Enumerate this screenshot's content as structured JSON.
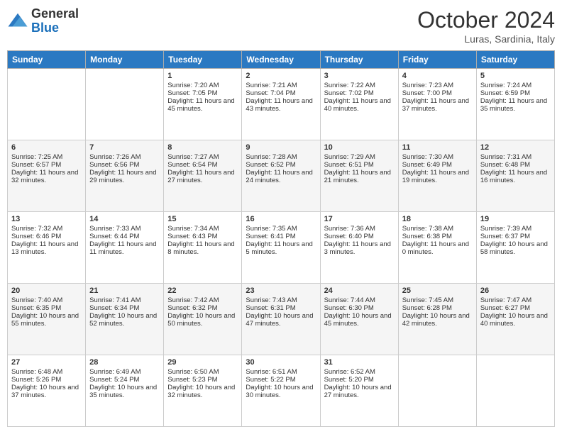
{
  "header": {
    "logo_general": "General",
    "logo_blue": "Blue",
    "month": "October 2024",
    "location": "Luras, Sardinia, Italy"
  },
  "weekdays": [
    "Sunday",
    "Monday",
    "Tuesday",
    "Wednesday",
    "Thursday",
    "Friday",
    "Saturday"
  ],
  "weeks": [
    [
      {
        "day": "",
        "sunrise": "",
        "sunset": "",
        "daylight": ""
      },
      {
        "day": "",
        "sunrise": "",
        "sunset": "",
        "daylight": ""
      },
      {
        "day": "1",
        "sunrise": "Sunrise: 7:20 AM",
        "sunset": "Sunset: 7:05 PM",
        "daylight": "Daylight: 11 hours and 45 minutes."
      },
      {
        "day": "2",
        "sunrise": "Sunrise: 7:21 AM",
        "sunset": "Sunset: 7:04 PM",
        "daylight": "Daylight: 11 hours and 43 minutes."
      },
      {
        "day": "3",
        "sunrise": "Sunrise: 7:22 AM",
        "sunset": "Sunset: 7:02 PM",
        "daylight": "Daylight: 11 hours and 40 minutes."
      },
      {
        "day": "4",
        "sunrise": "Sunrise: 7:23 AM",
        "sunset": "Sunset: 7:00 PM",
        "daylight": "Daylight: 11 hours and 37 minutes."
      },
      {
        "day": "5",
        "sunrise": "Sunrise: 7:24 AM",
        "sunset": "Sunset: 6:59 PM",
        "daylight": "Daylight: 11 hours and 35 minutes."
      }
    ],
    [
      {
        "day": "6",
        "sunrise": "Sunrise: 7:25 AM",
        "sunset": "Sunset: 6:57 PM",
        "daylight": "Daylight: 11 hours and 32 minutes."
      },
      {
        "day": "7",
        "sunrise": "Sunrise: 7:26 AM",
        "sunset": "Sunset: 6:56 PM",
        "daylight": "Daylight: 11 hours and 29 minutes."
      },
      {
        "day": "8",
        "sunrise": "Sunrise: 7:27 AM",
        "sunset": "Sunset: 6:54 PM",
        "daylight": "Daylight: 11 hours and 27 minutes."
      },
      {
        "day": "9",
        "sunrise": "Sunrise: 7:28 AM",
        "sunset": "Sunset: 6:52 PM",
        "daylight": "Daylight: 11 hours and 24 minutes."
      },
      {
        "day": "10",
        "sunrise": "Sunrise: 7:29 AM",
        "sunset": "Sunset: 6:51 PM",
        "daylight": "Daylight: 11 hours and 21 minutes."
      },
      {
        "day": "11",
        "sunrise": "Sunrise: 7:30 AM",
        "sunset": "Sunset: 6:49 PM",
        "daylight": "Daylight: 11 hours and 19 minutes."
      },
      {
        "day": "12",
        "sunrise": "Sunrise: 7:31 AM",
        "sunset": "Sunset: 6:48 PM",
        "daylight": "Daylight: 11 hours and 16 minutes."
      }
    ],
    [
      {
        "day": "13",
        "sunrise": "Sunrise: 7:32 AM",
        "sunset": "Sunset: 6:46 PM",
        "daylight": "Daylight: 11 hours and 13 minutes."
      },
      {
        "day": "14",
        "sunrise": "Sunrise: 7:33 AM",
        "sunset": "Sunset: 6:44 PM",
        "daylight": "Daylight: 11 hours and 11 minutes."
      },
      {
        "day": "15",
        "sunrise": "Sunrise: 7:34 AM",
        "sunset": "Sunset: 6:43 PM",
        "daylight": "Daylight: 11 hours and 8 minutes."
      },
      {
        "day": "16",
        "sunrise": "Sunrise: 7:35 AM",
        "sunset": "Sunset: 6:41 PM",
        "daylight": "Daylight: 11 hours and 5 minutes."
      },
      {
        "day": "17",
        "sunrise": "Sunrise: 7:36 AM",
        "sunset": "Sunset: 6:40 PM",
        "daylight": "Daylight: 11 hours and 3 minutes."
      },
      {
        "day": "18",
        "sunrise": "Sunrise: 7:38 AM",
        "sunset": "Sunset: 6:38 PM",
        "daylight": "Daylight: 11 hours and 0 minutes."
      },
      {
        "day": "19",
        "sunrise": "Sunrise: 7:39 AM",
        "sunset": "Sunset: 6:37 PM",
        "daylight": "Daylight: 10 hours and 58 minutes."
      }
    ],
    [
      {
        "day": "20",
        "sunrise": "Sunrise: 7:40 AM",
        "sunset": "Sunset: 6:35 PM",
        "daylight": "Daylight: 10 hours and 55 minutes."
      },
      {
        "day": "21",
        "sunrise": "Sunrise: 7:41 AM",
        "sunset": "Sunset: 6:34 PM",
        "daylight": "Daylight: 10 hours and 52 minutes."
      },
      {
        "day": "22",
        "sunrise": "Sunrise: 7:42 AM",
        "sunset": "Sunset: 6:32 PM",
        "daylight": "Daylight: 10 hours and 50 minutes."
      },
      {
        "day": "23",
        "sunrise": "Sunrise: 7:43 AM",
        "sunset": "Sunset: 6:31 PM",
        "daylight": "Daylight: 10 hours and 47 minutes."
      },
      {
        "day": "24",
        "sunrise": "Sunrise: 7:44 AM",
        "sunset": "Sunset: 6:30 PM",
        "daylight": "Daylight: 10 hours and 45 minutes."
      },
      {
        "day": "25",
        "sunrise": "Sunrise: 7:45 AM",
        "sunset": "Sunset: 6:28 PM",
        "daylight": "Daylight: 10 hours and 42 minutes."
      },
      {
        "day": "26",
        "sunrise": "Sunrise: 7:47 AM",
        "sunset": "Sunset: 6:27 PM",
        "daylight": "Daylight: 10 hours and 40 minutes."
      }
    ],
    [
      {
        "day": "27",
        "sunrise": "Sunrise: 6:48 AM",
        "sunset": "Sunset: 5:26 PM",
        "daylight": "Daylight: 10 hours and 37 minutes."
      },
      {
        "day": "28",
        "sunrise": "Sunrise: 6:49 AM",
        "sunset": "Sunset: 5:24 PM",
        "daylight": "Daylight: 10 hours and 35 minutes."
      },
      {
        "day": "29",
        "sunrise": "Sunrise: 6:50 AM",
        "sunset": "Sunset: 5:23 PM",
        "daylight": "Daylight: 10 hours and 32 minutes."
      },
      {
        "day": "30",
        "sunrise": "Sunrise: 6:51 AM",
        "sunset": "Sunset: 5:22 PM",
        "daylight": "Daylight: 10 hours and 30 minutes."
      },
      {
        "day": "31",
        "sunrise": "Sunrise: 6:52 AM",
        "sunset": "Sunset: 5:20 PM",
        "daylight": "Daylight: 10 hours and 27 minutes."
      },
      {
        "day": "",
        "sunrise": "",
        "sunset": "",
        "daylight": ""
      },
      {
        "day": "",
        "sunrise": "",
        "sunset": "",
        "daylight": ""
      }
    ]
  ]
}
